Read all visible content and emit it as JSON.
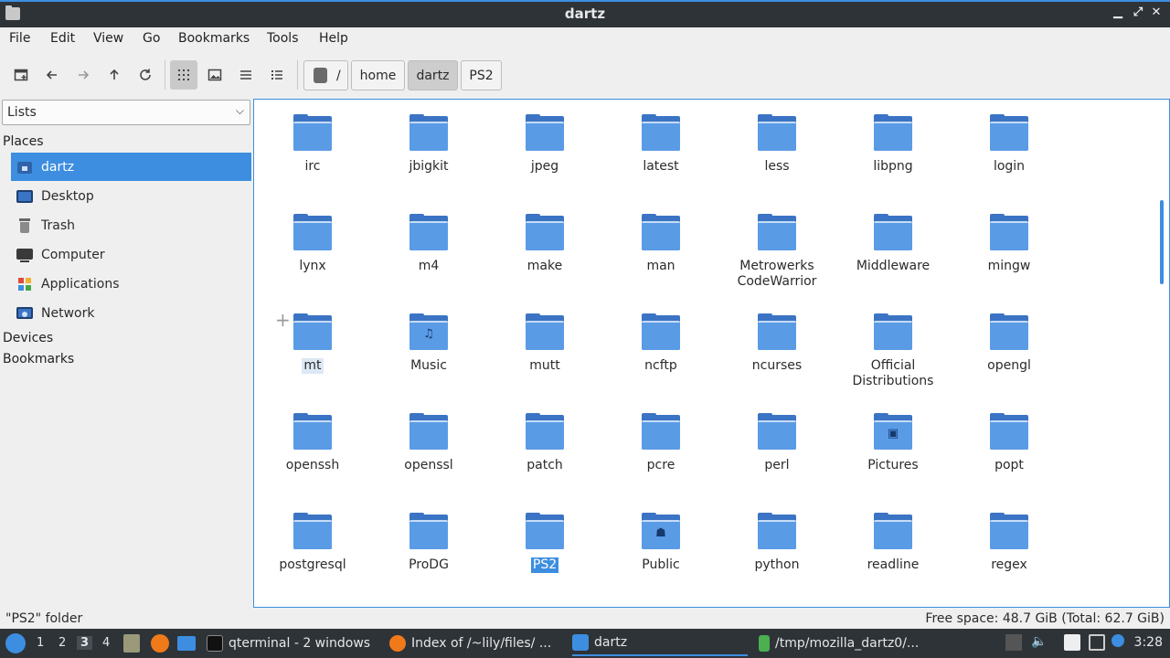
{
  "window": {
    "title": "dartz"
  },
  "menu": [
    "File",
    "Edit",
    "View",
    "Go",
    "Bookmarks",
    "Tools",
    "Help"
  ],
  "toolbar": {
    "icons": [
      "new-tab-icon",
      "back-icon",
      "forward-icon",
      "up-icon",
      "reload-icon",
      "icon-view-icon",
      "thumbnail-view-icon",
      "compact-view-icon",
      "detailed-list-icon"
    ],
    "path_root": "/",
    "crumbs": [
      "home",
      "dartz",
      "PS2"
    ]
  },
  "side": {
    "combo_value": "Lists",
    "places_title": "Places",
    "places": [
      {
        "label": "dartz",
        "icon": "home-icon"
      },
      {
        "label": "Desktop",
        "icon": "desktop-icon"
      },
      {
        "label": "Trash",
        "icon": "trash-icon"
      },
      {
        "label": "Computer",
        "icon": "computer-icon"
      },
      {
        "label": "Applications",
        "icon": "applications-icon"
      },
      {
        "label": "Network",
        "icon": "network-icon"
      }
    ],
    "devices_title": "Devices",
    "bookmarks_title": "Bookmarks"
  },
  "files": [
    {
      "name": "irc"
    },
    {
      "name": "jbigkit"
    },
    {
      "name": "jpeg"
    },
    {
      "name": "latest"
    },
    {
      "name": "less"
    },
    {
      "name": "libpng"
    },
    {
      "name": "login"
    },
    {
      "name": "lynx"
    },
    {
      "name": "m4"
    },
    {
      "name": "make"
    },
    {
      "name": "man"
    },
    {
      "name": "Metrowerks CodeWarrior"
    },
    {
      "name": "Middleware"
    },
    {
      "name": "mingw"
    },
    {
      "name": "mt",
      "state": "hover"
    },
    {
      "name": "Music",
      "emblem": "♫"
    },
    {
      "name": "mutt"
    },
    {
      "name": "ncftp"
    },
    {
      "name": "ncurses"
    },
    {
      "name": "Official Distributions"
    },
    {
      "name": "opengl"
    },
    {
      "name": "openssh"
    },
    {
      "name": "openssl"
    },
    {
      "name": "patch"
    },
    {
      "name": "pcre"
    },
    {
      "name": "perl"
    },
    {
      "name": "Pictures",
      "emblem": "▣"
    },
    {
      "name": "popt"
    },
    {
      "name": "postgresql"
    },
    {
      "name": "ProDG"
    },
    {
      "name": "PS2",
      "state": "selected"
    },
    {
      "name": "Public",
      "emblem": "☗"
    },
    {
      "name": "python"
    },
    {
      "name": "readline"
    },
    {
      "name": "regex"
    }
  ],
  "status": {
    "left": "\"PS2\" folder",
    "right": "Free space: 48.7 GiB (Total: 62.7 GiB)"
  },
  "taskbar": {
    "workspaces": [
      "1",
      "2",
      "3",
      "4"
    ],
    "current_workspace": "3",
    "tasks": [
      {
        "label": "qterminal - 2 windows",
        "icon": "terminal-icon"
      },
      {
        "label": "Index of /~lily/files/ ...",
        "icon": "firefox-icon"
      },
      {
        "label": "dartz",
        "icon": "folder-icon"
      },
      {
        "label": "/tmp/mozilla_dartz0/...",
        "icon": "file-icon"
      }
    ],
    "clock": "3:28"
  },
  "colors": {
    "accent": "#3d8ee0",
    "folder": "#5a9be6",
    "titlebar": "#2e3338"
  }
}
